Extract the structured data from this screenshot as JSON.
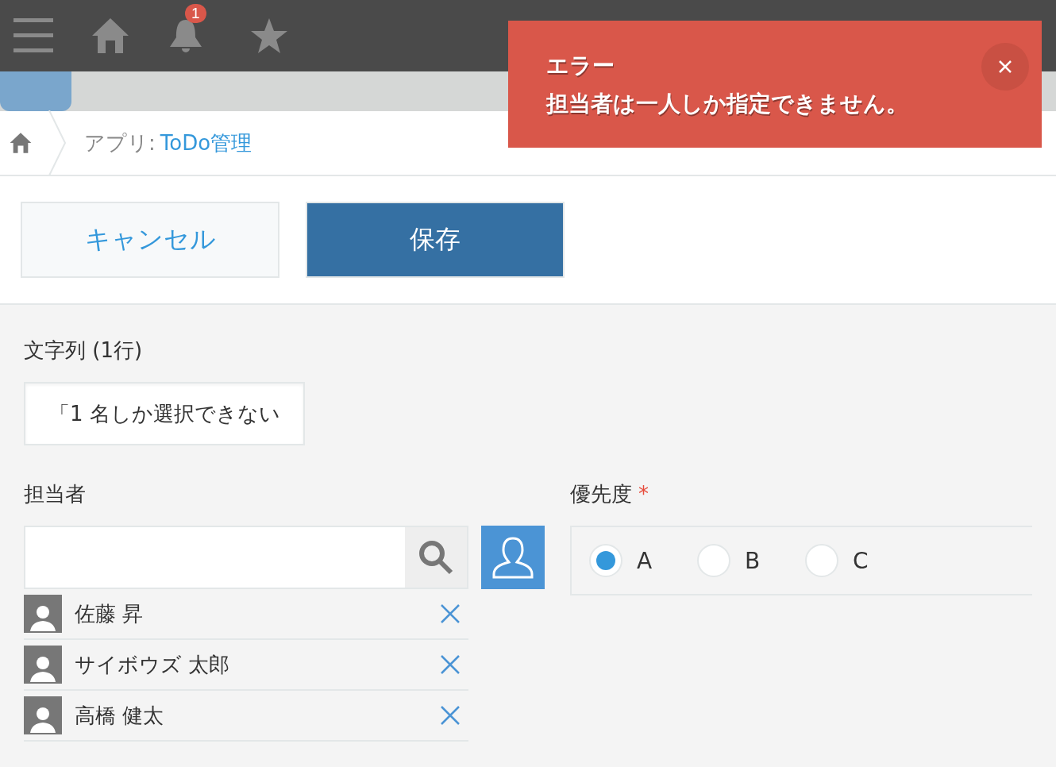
{
  "top_bar": {
    "notification_count": "1"
  },
  "breadcrumb": {
    "prefix": "アプリ:",
    "link": "ToDo管理"
  },
  "toast": {
    "title": "エラー",
    "message": "担当者は一人しか指定できません。"
  },
  "buttons": [
    {
      "label": "キャンセル",
      "kind": "secondary"
    },
    {
      "label": "保存",
      "kind": "primary"
    }
  ],
  "text_field": {
    "label": "文字列 (1行)",
    "value": "「1 名しか選択できない"
  },
  "assignee": {
    "label": "担当者",
    "users": [
      {
        "name": "佐藤 昇"
      },
      {
        "name": "サイボウズ 太郎"
      },
      {
        "name": "高橋 健太"
      }
    ]
  },
  "priority": {
    "label": "優先度",
    "required_mark": "*",
    "options": [
      {
        "label": "A",
        "selected": true
      },
      {
        "label": "B",
        "selected": false
      },
      {
        "label": "C",
        "selected": false
      }
    ]
  }
}
